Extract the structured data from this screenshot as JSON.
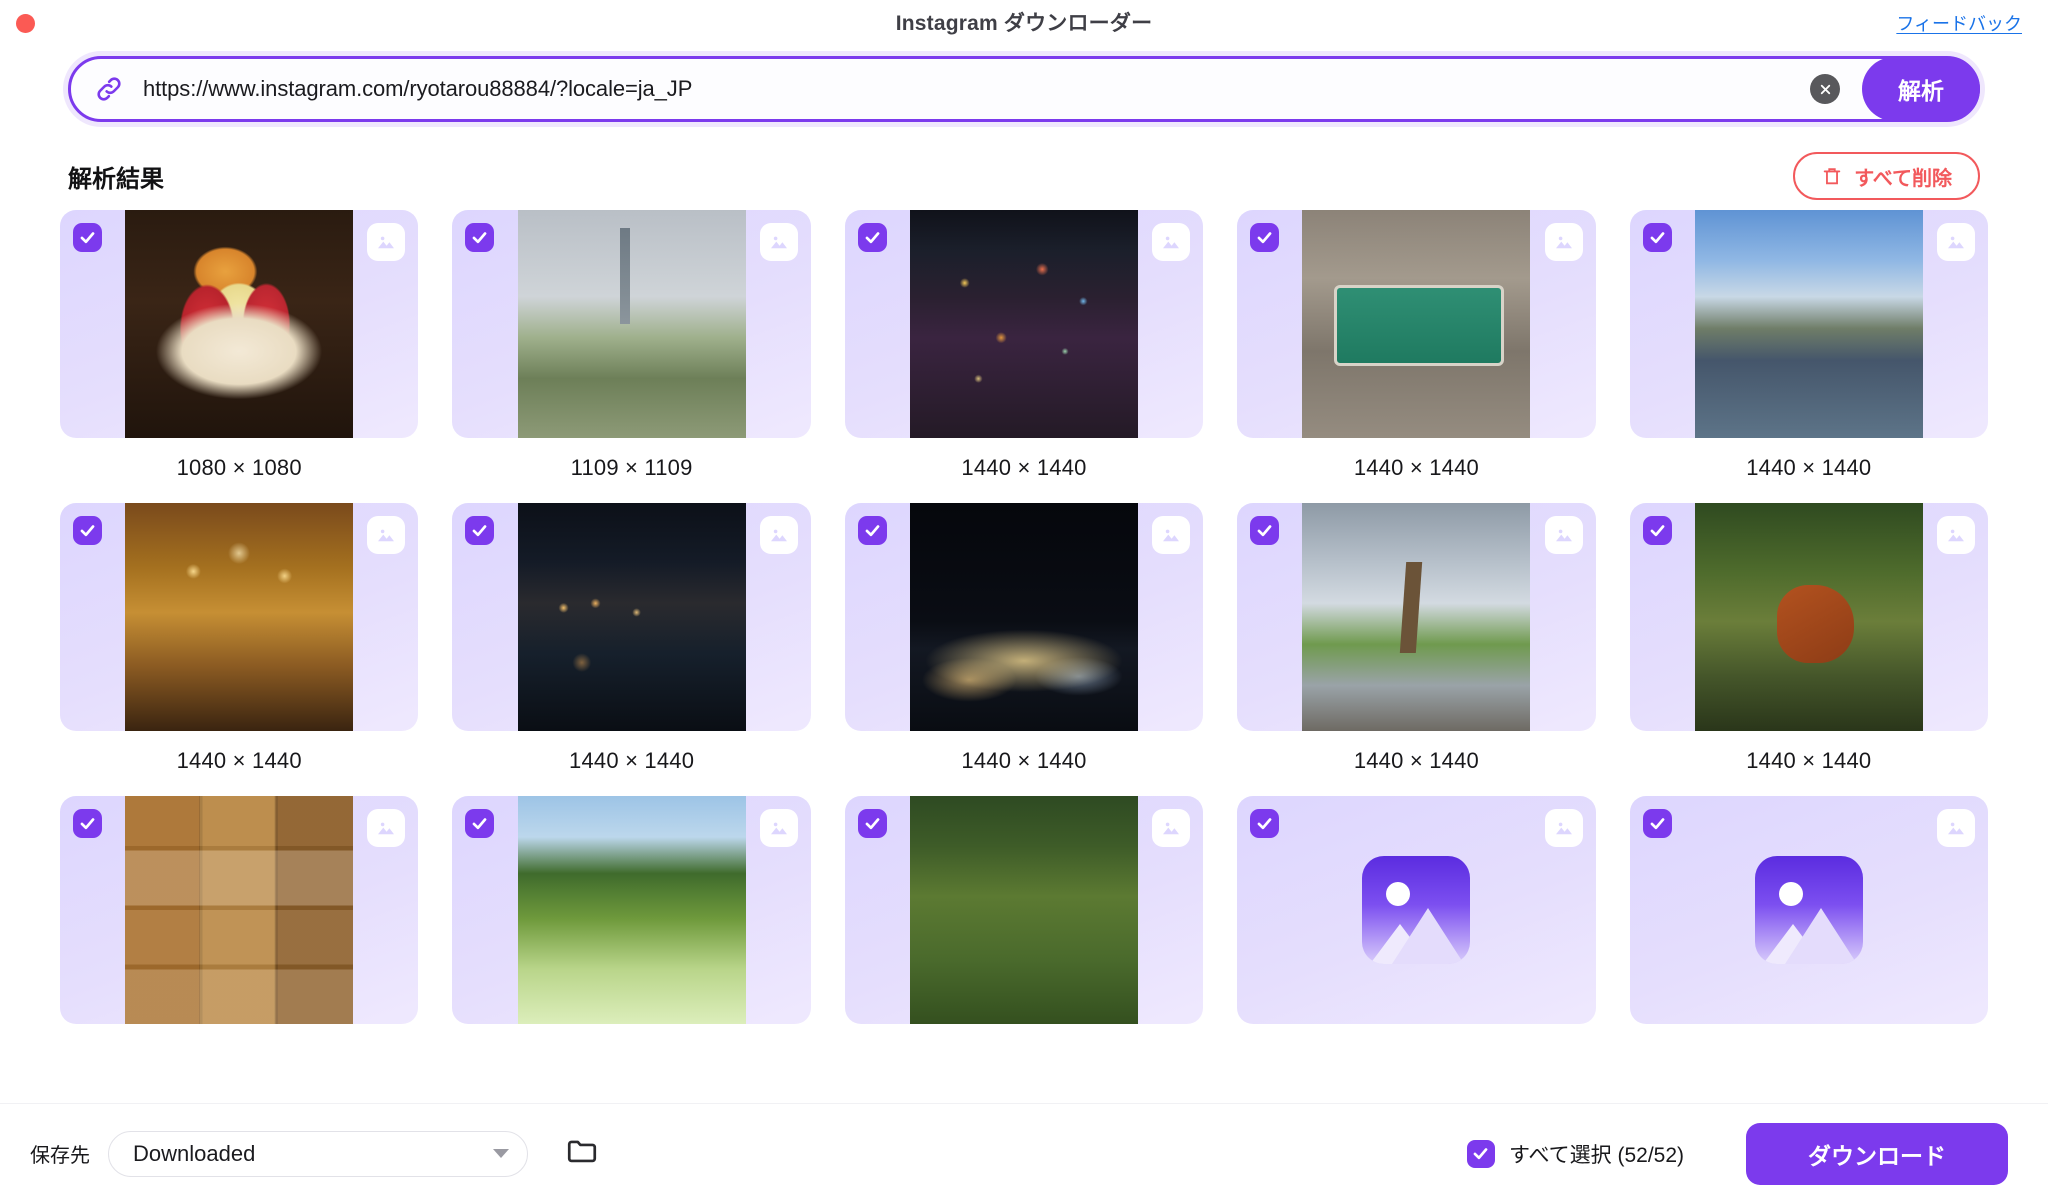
{
  "window": {
    "title": "Instagram ダウンローダー",
    "close_dot": "close-dot",
    "feedback_label": "フィードバック"
  },
  "colors": {
    "accent": "#7c3aed",
    "accent_light": "#ddd6fe",
    "danger": "#f2595c",
    "link": "#1a73e8",
    "close_dot": "#fb5a54"
  },
  "urlbar": {
    "link_icon": "link-icon",
    "value": "https://www.instagram.com/ryotarou88884/?locale=ja_JP",
    "placeholder": "https://www.instagram.com/",
    "clear_label": "✕",
    "analyze_label": "解析"
  },
  "results": {
    "title": "解析結果",
    "delete_all_label": "すべて削除",
    "items": [
      {
        "dimensions": "1080 × 1080",
        "checked": true,
        "art": "art-apples",
        "placeholder": false
      },
      {
        "dimensions": "1109 × 1109",
        "checked": true,
        "art": "art-tower",
        "placeholder": false
      },
      {
        "dimensions": "1440 × 1440",
        "checked": true,
        "art": "art-city",
        "placeholder": false
      },
      {
        "dimensions": "1440 × 1440",
        "checked": true,
        "art": "art-sign",
        "placeholder": false
      },
      {
        "dimensions": "1440 × 1440",
        "checked": true,
        "art": "art-canal-day",
        "placeholder": false
      },
      {
        "dimensions": "1440 × 1440",
        "checked": true,
        "art": "art-hall",
        "placeholder": false
      },
      {
        "dimensions": "1440 × 1440",
        "checked": true,
        "art": "art-canal-night",
        "placeholder": false
      },
      {
        "dimensions": "1440 × 1440",
        "checked": true,
        "art": "art-nightview",
        "placeholder": false
      },
      {
        "dimensions": "1440 × 1440",
        "checked": true,
        "art": "art-statue",
        "placeholder": false
      },
      {
        "dimensions": "1440 × 1440",
        "checked": true,
        "art": "art-panda",
        "placeholder": false
      },
      {
        "dimensions": "",
        "checked": true,
        "art": "art-foodgrid",
        "placeholder": false
      },
      {
        "dimensions": "",
        "checked": true,
        "art": "art-hydrangea-white",
        "placeholder": false
      },
      {
        "dimensions": "",
        "checked": true,
        "art": "art-hydrangea-pink",
        "placeholder": false
      },
      {
        "dimensions": "",
        "checked": true,
        "art": "",
        "placeholder": true
      },
      {
        "dimensions": "",
        "checked": true,
        "art": "",
        "placeholder": true
      }
    ]
  },
  "bottombar": {
    "save_to_label": "保存先",
    "folder_value": "Downloaded",
    "folder_browse_icon": "folder-icon",
    "select_all_label": "すべて選択 (52/52)",
    "select_all_checked": true,
    "download_label": "ダウンロード"
  }
}
